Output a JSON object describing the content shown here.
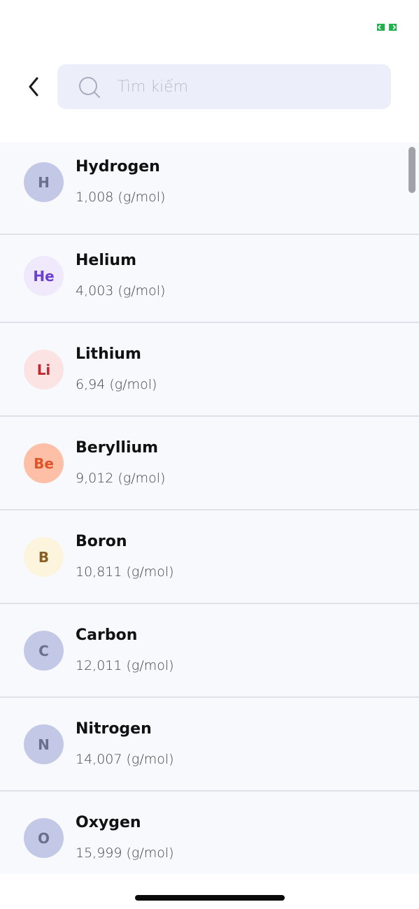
{
  "search": {
    "placeholder": "Tìm kiếm"
  },
  "elements": [
    {
      "symbol": "H",
      "name": "Hydrogen",
      "mass": "1,008 (g/mol)",
      "bg": "#c3c8e6",
      "fg": "#6a6f8e"
    },
    {
      "symbol": "He",
      "name": "Helium",
      "mass": "4,003 (g/mol)",
      "bg": "#efe9fb",
      "fg": "#6b3fd1"
    },
    {
      "symbol": "Li",
      "name": "Lithium",
      "mass": "6,94 (g/mol)",
      "bg": "#fbe3e3",
      "fg": "#c0272f"
    },
    {
      "symbol": "Be",
      "name": "Beryllium",
      "mass": "9,012 (g/mol)",
      "bg": "#fdbfa6",
      "fg": "#e0542a"
    },
    {
      "symbol": "B",
      "name": "Boron",
      "mass": "10,811 (g/mol)",
      "bg": "#fdf4dd",
      "fg": "#8b5f24"
    },
    {
      "symbol": "C",
      "name": "Carbon",
      "mass": "12,011 (g/mol)",
      "bg": "#c3c8e6",
      "fg": "#6a6f8e"
    },
    {
      "symbol": "N",
      "name": "Nitrogen",
      "mass": "14,007 (g/mol)",
      "bg": "#c3c8e6",
      "fg": "#6a6f8e"
    },
    {
      "symbol": "O",
      "name": "Oxygen",
      "mass": "15,999 (g/mol)",
      "bg": "#c3c8e6",
      "fg": "#6a6f8e"
    }
  ],
  "colors": {
    "accent_status": "#22b14c",
    "search_bg": "#eceff9",
    "list_bg": "#f8f9fc"
  },
  "icons": {
    "back": "chevron-left-icon",
    "search": "search-icon",
    "status": "expand-icon"
  }
}
